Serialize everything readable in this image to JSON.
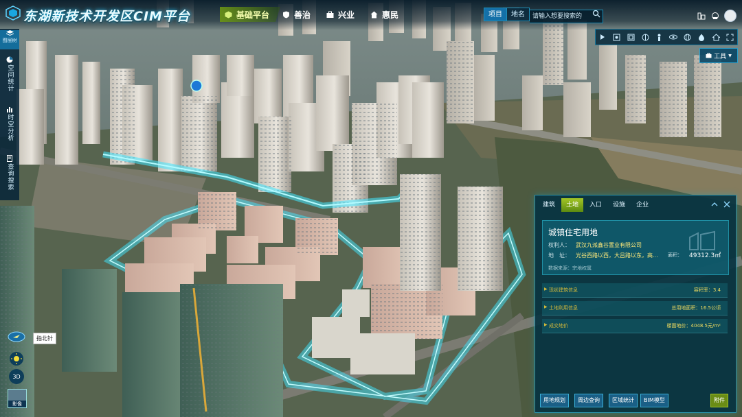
{
  "app": {
    "title": "东湖新技术开发区CIM平台"
  },
  "nav": [
    {
      "label": "基础平台",
      "active": true,
      "icon": "cube-icon"
    },
    {
      "label": "善治",
      "active": false,
      "icon": "shield-icon"
    },
    {
      "label": "兴业",
      "active": false,
      "icon": "briefcase-icon"
    },
    {
      "label": "惠民",
      "active": false,
      "icon": "house-icon"
    }
  ],
  "search": {
    "tabs": [
      "项目",
      "地名"
    ],
    "active_tab": "项目",
    "placeholder": "请输入想要搜索的"
  },
  "sidebar": {
    "items": [
      {
        "label": "图层树",
        "icon": "layers-icon"
      },
      {
        "label": "空间统计",
        "icon": "pie-icon"
      },
      {
        "label": "时空分析",
        "icon": "chart-icon"
      },
      {
        "label": "查询搜索",
        "icon": "document-icon"
      }
    ],
    "compass_tooltip": "指北针",
    "view_3d_label": "3D",
    "layer_thumb_label": "影像"
  },
  "toolbar": {
    "tools_label": "工具",
    "icons": [
      "play-icon",
      "screenshot-icon",
      "frame-icon",
      "split-icon",
      "person-icon",
      "eye-icon",
      "globe-icon",
      "drop-icon",
      "home-icon",
      "fullscreen-icon"
    ]
  },
  "panel": {
    "tabs": [
      "建筑",
      "土地",
      "入口",
      "设施",
      "企业"
    ],
    "active_tab": "土地",
    "title": "城镇住宅用地",
    "owner_label": "权利人：",
    "owner": "武汉九派鑫谷置业有限公司",
    "address_label": "地　址：",
    "address": "光谷西路以西，大吕路以东，高...",
    "area_label": "面积：",
    "area": "49312.3㎡",
    "source": "数据来源：宗地权属",
    "rows": [
      {
        "label": "现状建筑信息",
        "value": "容积率：3.4"
      },
      {
        "label": "土地利用信息",
        "value": "总用地面积：16.5公顷"
      },
      {
        "label": "成交地价",
        "value": "楼面地价：4048.5元/m²"
      }
    ],
    "buttons": [
      "用地规划",
      "周边查询",
      "区域统计",
      "BIM模型"
    ],
    "attach_label": "附件"
  },
  "colors": {
    "accent_green": "#a4c626",
    "accent_blue": "#1470a8",
    "road_glow": "#3fe6ff"
  }
}
